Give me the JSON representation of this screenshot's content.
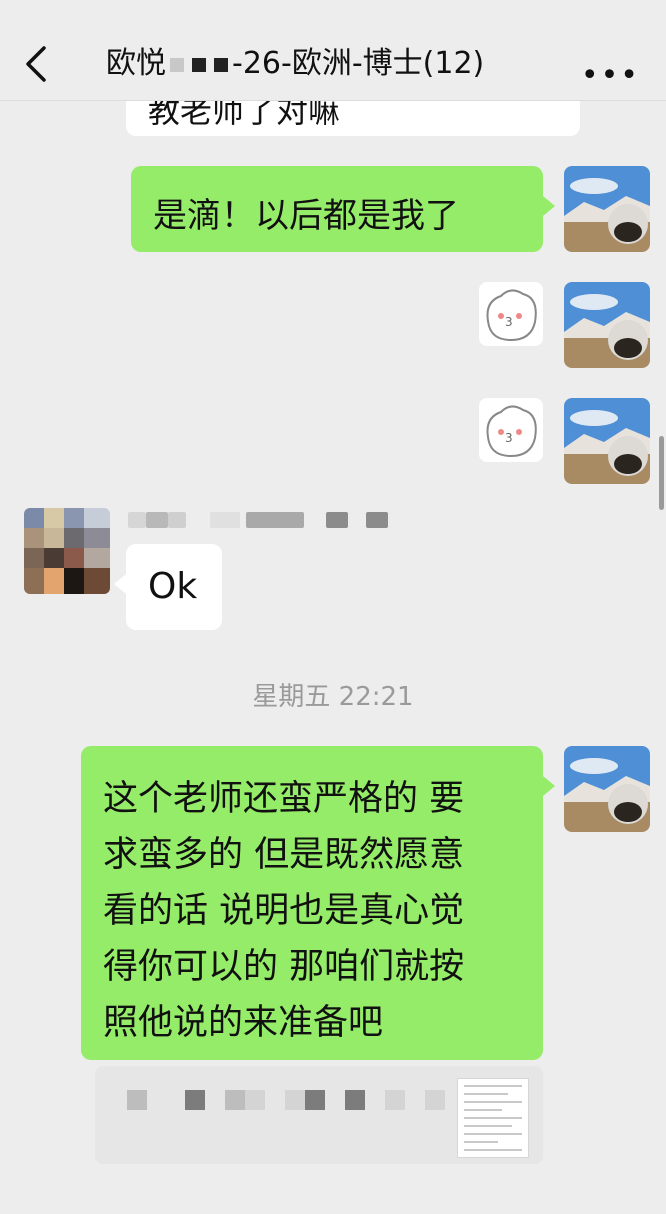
{
  "header": {
    "title_prefix": "欧悦",
    "title_suffix": "-26-欧洲-博士(12)",
    "more_label": "•••"
  },
  "messages": {
    "top_partial": "教老师了对嘛",
    "reply1": "是滴！以后都是我了",
    "ok": "Ok",
    "long_lines": [
      "这个老师还蛮严格的 要",
      "求蛮多的 但是既然愿意",
      "看的话 说明也是真心觉",
      "得你可以的 那咱们就按",
      "照他说的来准备吧"
    ]
  },
  "timestamp": "星期五 22:21",
  "colors": {
    "background": "#ededed",
    "outgoing_bubble": "#95ec69",
    "incoming_bubble": "#ffffff"
  }
}
